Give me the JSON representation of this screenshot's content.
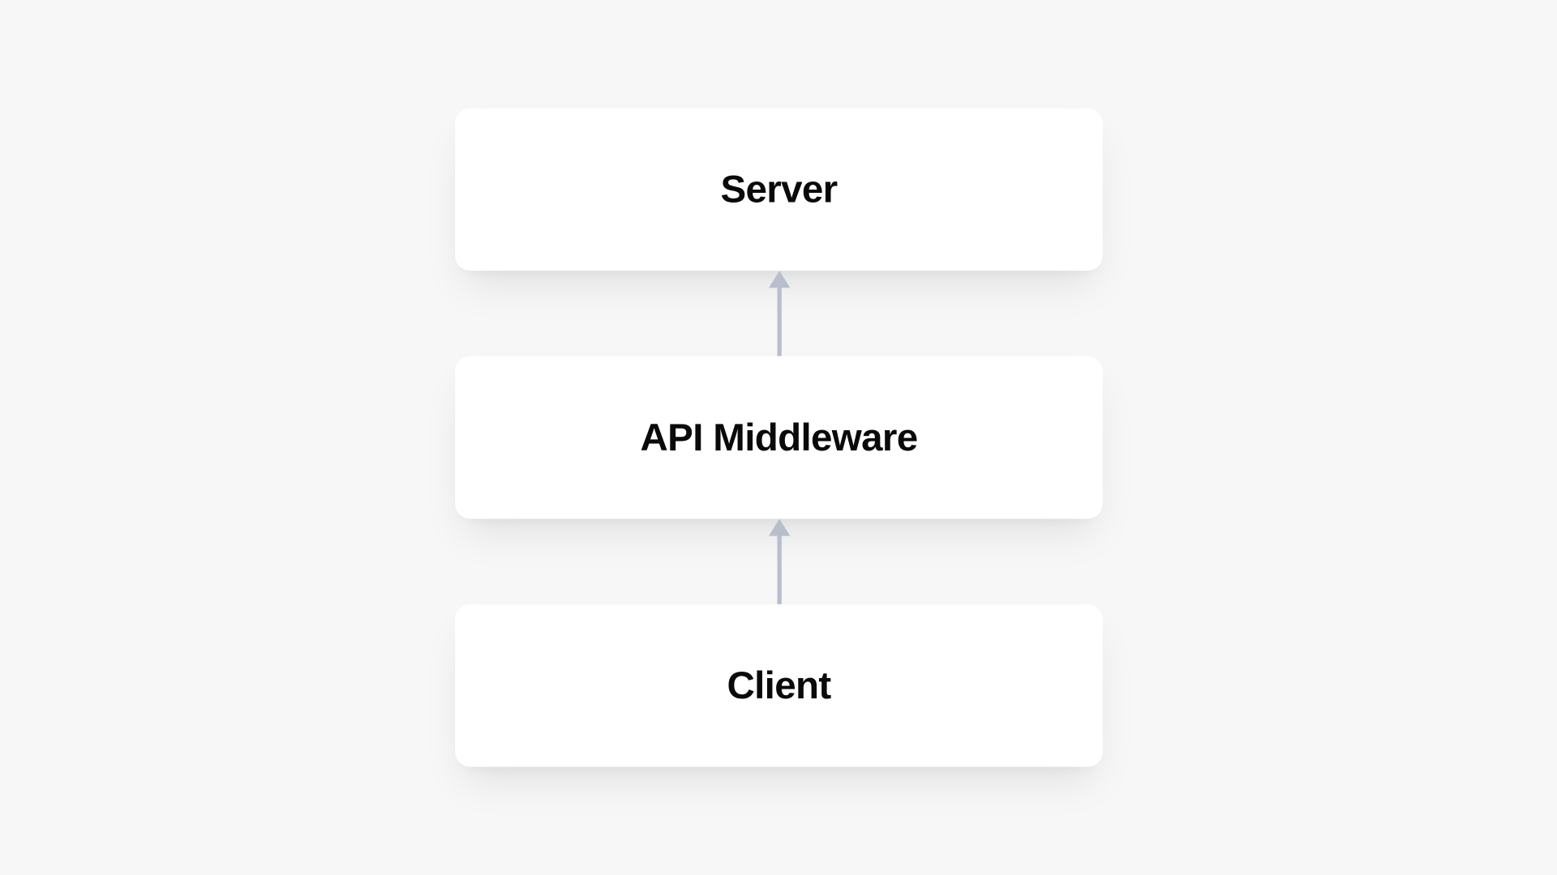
{
  "diagram": {
    "nodes": {
      "top": "Server",
      "middle": "API Middleware",
      "bottom": "Client"
    },
    "colors": {
      "background": "#f7f7f7",
      "node_bg": "#ffffff",
      "text": "#0a0a0a",
      "arrow": "#b8becc"
    },
    "flow_direction": "upward"
  }
}
